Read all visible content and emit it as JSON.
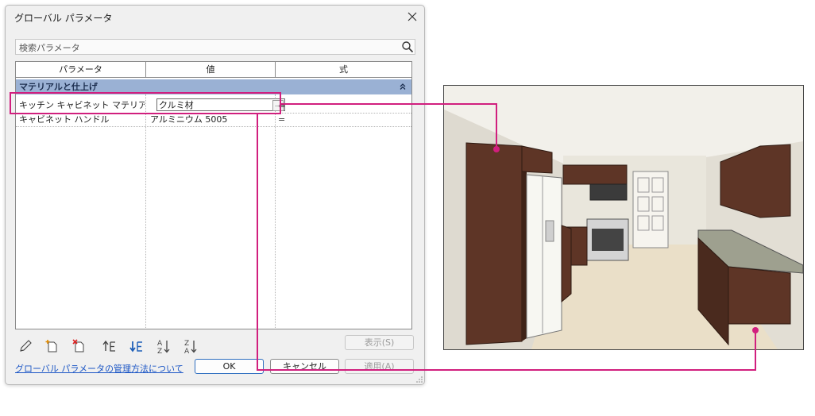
{
  "window": {
    "title": "グローバル パラメータ"
  },
  "search": {
    "placeholder": "検索パラメータ"
  },
  "table": {
    "columns": [
      "パラメータ",
      "値",
      "式"
    ],
    "group": {
      "label": "マテリアルと仕上げ"
    },
    "rows": [
      {
        "name": "キッチン キャビネット マテリアル",
        "value": "クルミ材",
        "formula": "="
      },
      {
        "name": "キャビネット ハンドル",
        "value": "アルミニウム 5005",
        "formula": "="
      }
    ]
  },
  "toolbar": {
    "icons": [
      "pencil-edit-icon",
      "new-parameter-icon",
      "delete-parameter-icon",
      "move-up-icon",
      "move-down-icon",
      "sort-ascending-icon",
      "sort-descending-icon"
    ]
  },
  "buttons": {
    "show": "表示(S)",
    "ok": "OK",
    "cancel": "キャンセル",
    "apply": "適用(A)"
  },
  "help_link": "グローバル パラメータの管理方法について",
  "colors": {
    "callout": "#d11f7e",
    "group_header": "#9ab1d4",
    "link": "#1a55c5",
    "cabinet": "#5e3526"
  }
}
